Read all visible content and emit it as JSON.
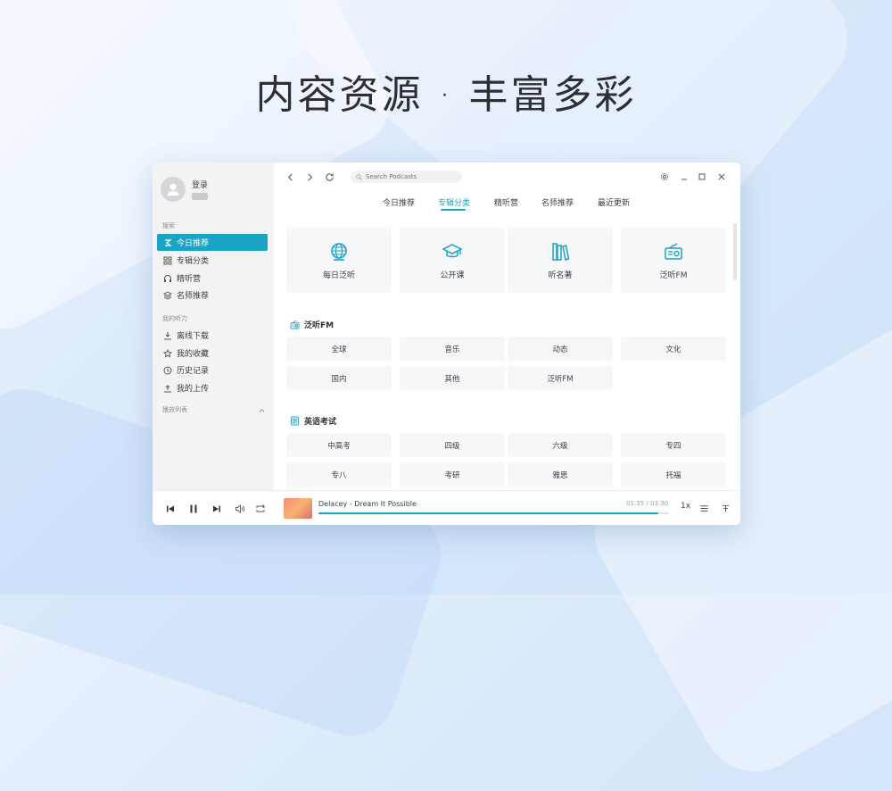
{
  "headline": "内容资源 · 丰富多彩",
  "colors": {
    "accent": "#1aa3c4",
    "sidebar_bg": "#f3f3f4"
  },
  "user": {
    "login_label": "登录"
  },
  "sidebar": {
    "group1_label": "搜索",
    "items": [
      {
        "label": "今日推荐",
        "icon": "recommend-icon"
      },
      {
        "label": "专辑分类",
        "icon": "grid-icon"
      },
      {
        "label": "精听营",
        "icon": "headphone-icon"
      },
      {
        "label": "名师推荐",
        "icon": "layers-icon"
      }
    ],
    "group2_label": "我的听力",
    "items2": [
      {
        "label": "离线下载",
        "icon": "download-icon"
      },
      {
        "label": "我的收藏",
        "icon": "star-icon"
      },
      {
        "label": "历史记录",
        "icon": "history-icon"
      },
      {
        "label": "我的上传",
        "icon": "upload-icon"
      }
    ],
    "playlist_label": "播放列表"
  },
  "search": {
    "placeholder": "Search Podcasts"
  },
  "tabs": [
    "今日推荐",
    "专辑分类",
    "精听营",
    "名师推荐",
    "最近更新"
  ],
  "active_tab": 1,
  "cards": [
    {
      "label": "每日泛听",
      "icon": "globe-icon"
    },
    {
      "label": "公开课",
      "icon": "graduation-cap-icon"
    },
    {
      "label": "听名著",
      "icon": "books-icon"
    },
    {
      "label": "泛听FM",
      "icon": "radio-icon"
    }
  ],
  "section1": {
    "title": "泛听FM",
    "icon": "radio-icon",
    "cells": [
      "全球",
      "音乐",
      "动态",
      "文化",
      "国内",
      "其他",
      "泛听FM"
    ]
  },
  "section2": {
    "title": "英语考试",
    "icon": "book-icon",
    "cells": [
      "中高考",
      "四级",
      "六级",
      "专四",
      "专八",
      "考研",
      "雅思",
      "托福"
    ]
  },
  "player": {
    "track": "Delacey - Dream It Possible",
    "time": "01:35 / 03:30",
    "progress": 0.97,
    "speed": "1x"
  }
}
